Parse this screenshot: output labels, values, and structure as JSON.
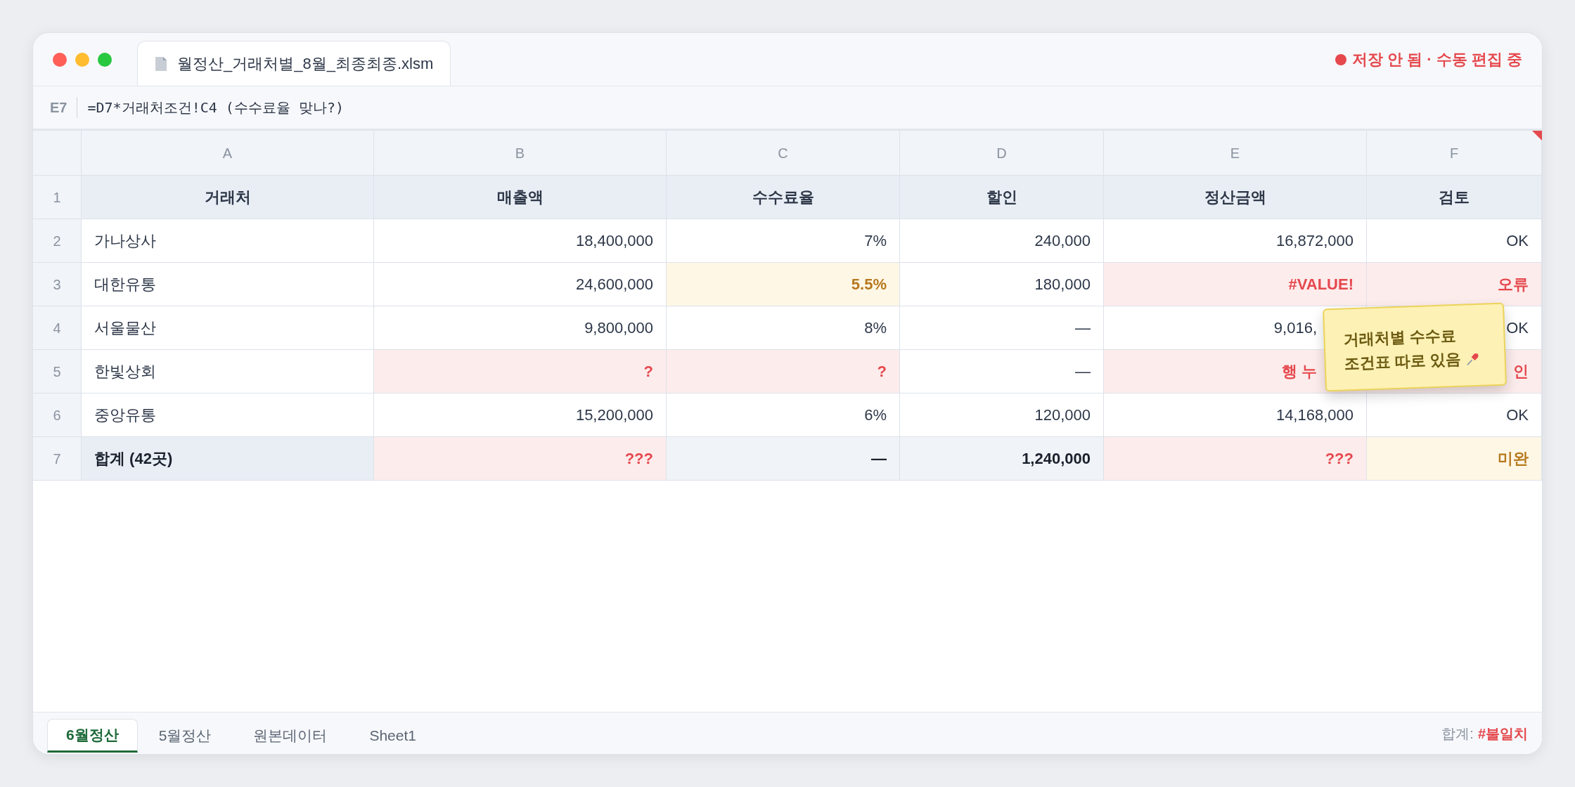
{
  "window": {
    "file_tab": "월정산_거래처별_8월_최종최종.xlsm",
    "status": "저장 안 됨 · 수동 편집 중"
  },
  "formula_bar": {
    "cell_ref": "E7",
    "formula": "=D7*거래처조건!C4 (수수료율 맞나?)"
  },
  "columns": [
    "A",
    "B",
    "C",
    "D",
    "E",
    "F"
  ],
  "rows": [
    {
      "num": "1",
      "cells": [
        {
          "text": "거래처",
          "kind": "header"
        },
        {
          "text": "매출액",
          "kind": "header"
        },
        {
          "text": "수수료율",
          "kind": "header"
        },
        {
          "text": "할인",
          "kind": "header"
        },
        {
          "text": "정산금액",
          "kind": "header"
        },
        {
          "text": "검토",
          "kind": "header"
        }
      ]
    },
    {
      "num": "2",
      "cells": [
        {
          "text": "가나상사",
          "kind": "normal"
        },
        {
          "text": "18,400,000",
          "kind": "normal"
        },
        {
          "text": "7%",
          "kind": "normal"
        },
        {
          "text": "240,000",
          "kind": "normal"
        },
        {
          "text": "16,872,000",
          "kind": "normal"
        },
        {
          "text": "OK",
          "kind": "normal"
        }
      ]
    },
    {
      "num": "3",
      "cells": [
        {
          "text": "대한유통",
          "kind": "normal"
        },
        {
          "text": "24,600,000",
          "kind": "normal"
        },
        {
          "text": "5.5%",
          "kind": "warn"
        },
        {
          "text": "180,000",
          "kind": "normal"
        },
        {
          "text": "#VALUE!",
          "kind": "error"
        },
        {
          "text": "오류",
          "kind": "error"
        }
      ]
    },
    {
      "num": "4",
      "cells": [
        {
          "text": "서울물산",
          "kind": "normal"
        },
        {
          "text": "9,800,000",
          "kind": "normal"
        },
        {
          "text": "8%",
          "kind": "normal"
        },
        {
          "text": "—",
          "kind": "normal"
        },
        {
          "text": "9,016,",
          "kind": "normal",
          "clipped": true
        },
        {
          "text": "OK",
          "kind": "normal"
        }
      ]
    },
    {
      "num": "5",
      "cells": [
        {
          "text": "한빛상회",
          "kind": "normal"
        },
        {
          "text": "?",
          "kind": "error"
        },
        {
          "text": "?",
          "kind": "error"
        },
        {
          "text": "—",
          "kind": "normal"
        },
        {
          "text": "행 누",
          "kind": "error",
          "clipped": true
        },
        {
          "text": "인",
          "kind": "error"
        }
      ]
    },
    {
      "num": "6",
      "cells": [
        {
          "text": "중앙유통",
          "kind": "normal"
        },
        {
          "text": "15,200,000",
          "kind": "normal"
        },
        {
          "text": "6%",
          "kind": "normal"
        },
        {
          "text": "120,000",
          "kind": "normal"
        },
        {
          "text": "14,168,000",
          "kind": "normal"
        },
        {
          "text": "OK",
          "kind": "normal"
        }
      ]
    },
    {
      "num": "7",
      "cells": [
        {
          "text": "합계 (42곳)",
          "kind": "total"
        },
        {
          "text": "???",
          "kind": "error"
        },
        {
          "text": "—",
          "kind": "total"
        },
        {
          "text": "1,240,000",
          "kind": "total"
        },
        {
          "text": "???",
          "kind": "error"
        },
        {
          "text": "미완",
          "kind": "warn"
        }
      ]
    }
  ],
  "sticky_note": {
    "lines": [
      "거래처별 수수료",
      "조건표 따로 있음"
    ]
  },
  "sheet_tabs": [
    {
      "label": "6월정산",
      "selected": true
    },
    {
      "label": "5월정산",
      "selected": false
    },
    {
      "label": "원본데이터",
      "selected": false
    },
    {
      "label": "Sheet1",
      "selected": false
    }
  ],
  "status_bar": {
    "label": "합계:",
    "value": "#불일치"
  }
}
